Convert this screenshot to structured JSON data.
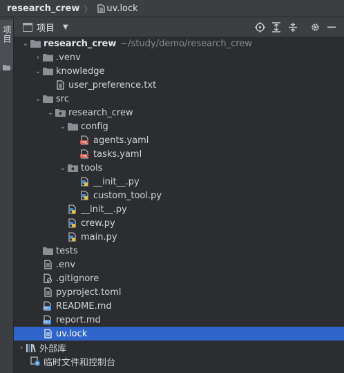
{
  "breadcrumb": {
    "project": "research_crew",
    "file": "uv.lock"
  },
  "stripe": {
    "label": "项目"
  },
  "header": {
    "title": "项目"
  },
  "tree": {
    "root": {
      "name": "research_crew",
      "path": "~/study/demo/research_crew"
    },
    "venv": ".venv",
    "knowledge": "knowledge",
    "user_pref": "user_preference.txt",
    "src": "src",
    "pkg": "research_crew",
    "config": "config",
    "agents": "agents.yaml",
    "tasks": "tasks.yaml",
    "tools": "tools",
    "tools_init": "__init__.py",
    "custom_tool": "custom_tool.py",
    "pkg_init": "__init__.py",
    "crew": "crew.py",
    "main": "main.py",
    "tests": "tests",
    "env": ".env",
    "gitignore": ".gitignore",
    "pyproject": "pyproject.toml",
    "readme": "README.md",
    "report": "report.md",
    "uvlock": "uv.lock",
    "extlibs": "外部库",
    "scratches": "临时文件和控制台"
  },
  "colors": {
    "selection": "#2f65ca",
    "folder": "#8b8e94",
    "python_blue": "#4a8ad6",
    "python_yellow": "#e0c24a",
    "yaml_red": "#c2564b",
    "markdown_blue": "#4a8ad6"
  }
}
